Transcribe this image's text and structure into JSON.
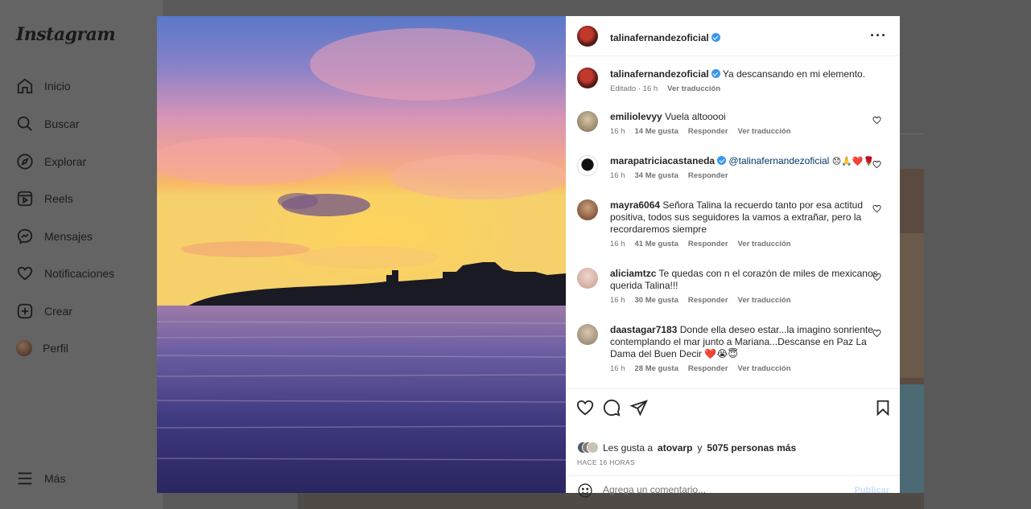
{
  "app": {
    "logo": "Instagram"
  },
  "sidebar": {
    "items": [
      {
        "label": "Inicio",
        "icon": "home-icon"
      },
      {
        "label": "Buscar",
        "icon": "search-icon"
      },
      {
        "label": "Explorar",
        "icon": "compass-icon"
      },
      {
        "label": "Reels",
        "icon": "reels-icon"
      },
      {
        "label": "Mensajes",
        "icon": "messenger-icon"
      },
      {
        "label": "Notificaciones",
        "icon": "heart-icon"
      },
      {
        "label": "Crear",
        "icon": "plus-square-icon"
      },
      {
        "label": "Perfil",
        "icon": "avatar"
      }
    ],
    "more_label": "Más"
  },
  "post": {
    "owner": "talinafernandezoficial",
    "caption": "Ya descansando en mi elemento.",
    "caption_meta": {
      "time": "Editado · 16 h",
      "translate": "Ver traducción"
    },
    "comments": [
      {
        "user": "emiliolevyy",
        "text": "Vuela altooooi",
        "time": "16 h",
        "likes": "14 Me gusta",
        "reply": "Responder",
        "translate": "Ver traducción"
      },
      {
        "user": "marapatriciacastaneda",
        "mention": "@talinafernandezoficial",
        "text": "😞🙏❤️🌹",
        "time": "16 h",
        "likes": "34 Me gusta",
        "reply": "Responder"
      },
      {
        "user": "mayra6064",
        "text": "Señora Talina la recuerdo tanto por esa actitud positiva, todos sus seguidores la vamos a extrañar, pero la recordaremos siempre",
        "time": "16 h",
        "likes": "41 Me gusta",
        "reply": "Responder",
        "translate": "Ver traducción"
      },
      {
        "user": "aliciamtzc",
        "text": "Te quedas con n el corazón de miles de mexicanos querida Talina!!!",
        "time": "16 h",
        "likes": "30 Me gusta",
        "reply": "Responder",
        "translate": "Ver traducción"
      },
      {
        "user": "daastagar7183",
        "text": "Donde ella deseo estar...la imagino sonriente contemplando el mar junto a Mariana...Descanse en Paz La Dama del Buen Decir ❤️😭😇",
        "time": "16 h",
        "likes": "28 Me gusta",
        "reply": "Responder",
        "translate": "Ver traducción"
      }
    ],
    "likes": {
      "prefix": "Les gusta a",
      "user": "atovarp",
      "conj": "y",
      "others": "5075 personas más"
    },
    "time_ago": "HACE 16 HORAS",
    "comment_box": {
      "placeholder": "Agrega un comentario...",
      "publish": "Publicar"
    }
  }
}
